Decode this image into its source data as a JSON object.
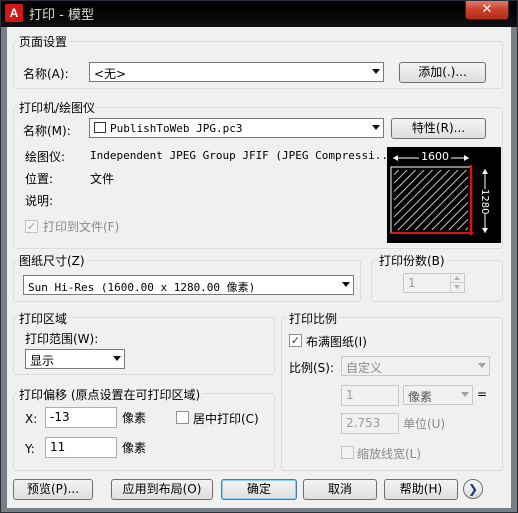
{
  "window": {
    "title": "打印 - 模型",
    "app_icon_letter": "A",
    "close_glyph": "✕"
  },
  "page_setup": {
    "group_label": "页面设置",
    "name_label": "名称(A):",
    "name_value": "<无>",
    "add_button": "添加(.)..."
  },
  "printer": {
    "group_label": "打印机/绘图仪",
    "name_label": "名称(M):",
    "name_value": "PublishToWeb JPG.pc3",
    "properties_button": "特性(R)...",
    "plotter_label": "绘图仪:",
    "plotter_value": "Independent JPEG Group JFIF (JPEG Compressi...",
    "location_label": "位置:",
    "location_value": "文件",
    "description_label": "说明:",
    "print_to_file_label": "打印到文件(F)",
    "print_to_file_checked": true,
    "preview_width_label": "1600",
    "preview_height_label": "1280"
  },
  "paper_size": {
    "group_label": "图纸尺寸(Z)",
    "value": "Sun Hi-Res (1600.00 x 1280.00 像素)"
  },
  "copies": {
    "group_label": "打印份数(B)",
    "value": "1"
  },
  "plot_area": {
    "group_label": "打印区域",
    "range_label": "打印范围(W):",
    "range_value": "显示"
  },
  "plot_offset": {
    "group_label": "打印偏移 (原点设置在可打印区域)",
    "x_label": "X:",
    "x_value": "-13",
    "x_unit": "像素",
    "y_label": "Y:",
    "y_value": "11",
    "y_unit": "像素",
    "center_label": "居中打印(C)",
    "center_checked": false
  },
  "plot_scale": {
    "group_label": "打印比例",
    "fit_label": "布满图纸(I)",
    "fit_checked": true,
    "scale_label": "比例(S):",
    "scale_value": "自定义",
    "value1": "1",
    "unit_value": "像素",
    "equals": "=",
    "value2": "2.753",
    "unit2_label": "单位(U)",
    "lineweight_label": "缩放线宽(L)",
    "lineweight_checked": false
  },
  "footer": {
    "preview_button": "预览(P)...",
    "apply_button": "应用到布局(O)",
    "ok_button": "确定",
    "cancel_button": "取消",
    "help_button": "帮助(H)",
    "more_glyph": "❯"
  }
}
